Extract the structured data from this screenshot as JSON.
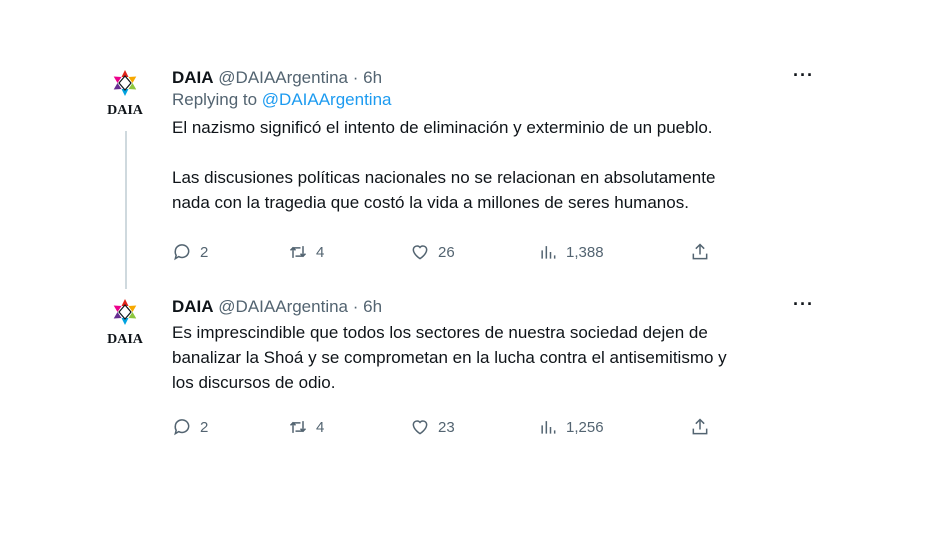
{
  "tweets": [
    {
      "name": "DAIA",
      "handle": "@DAIAArgentina",
      "separator": "·",
      "time": "6h",
      "more": "···",
      "replying_prefix": "Replying to ",
      "replying_handle": "@DAIAArgentina",
      "text": "El nazismo significó el intento de eliminación y exterminio de un pueblo.\n\nLas discusiones políticas nacionales no se relacionan en absolutamente\nnada con la tragedia que costó la vida a millones de seres humanos.",
      "avatar_text": "DAIA",
      "replies": "2",
      "retweets": "4",
      "likes": "26",
      "views": "1,388"
    },
    {
      "name": "DAIA",
      "handle": "@DAIAArgentina",
      "separator": "·",
      "time": "6h",
      "more": "···",
      "text": "Es imprescindible que todos los sectores de nuestra sociedad dejen de\nbanalizar la Shoá y se comprometan en la lucha contra el antisemitismo y\nlos discursos de odio.",
      "avatar_text": "DAIA",
      "replies": "2",
      "retweets": "4",
      "likes": "23",
      "views": "1,256"
    }
  ],
  "colors": {
    "link": "#1d9bf0",
    "muted": "#536471",
    "text": "#0f1419",
    "thread_line": "#cfd9de"
  },
  "icons": {
    "reply": "speech-bubble-icon",
    "retweet": "retweet-icon",
    "like": "heart-icon",
    "views": "bar-chart-icon",
    "share": "share-upload-icon",
    "logo": "star-of-david-logo"
  }
}
